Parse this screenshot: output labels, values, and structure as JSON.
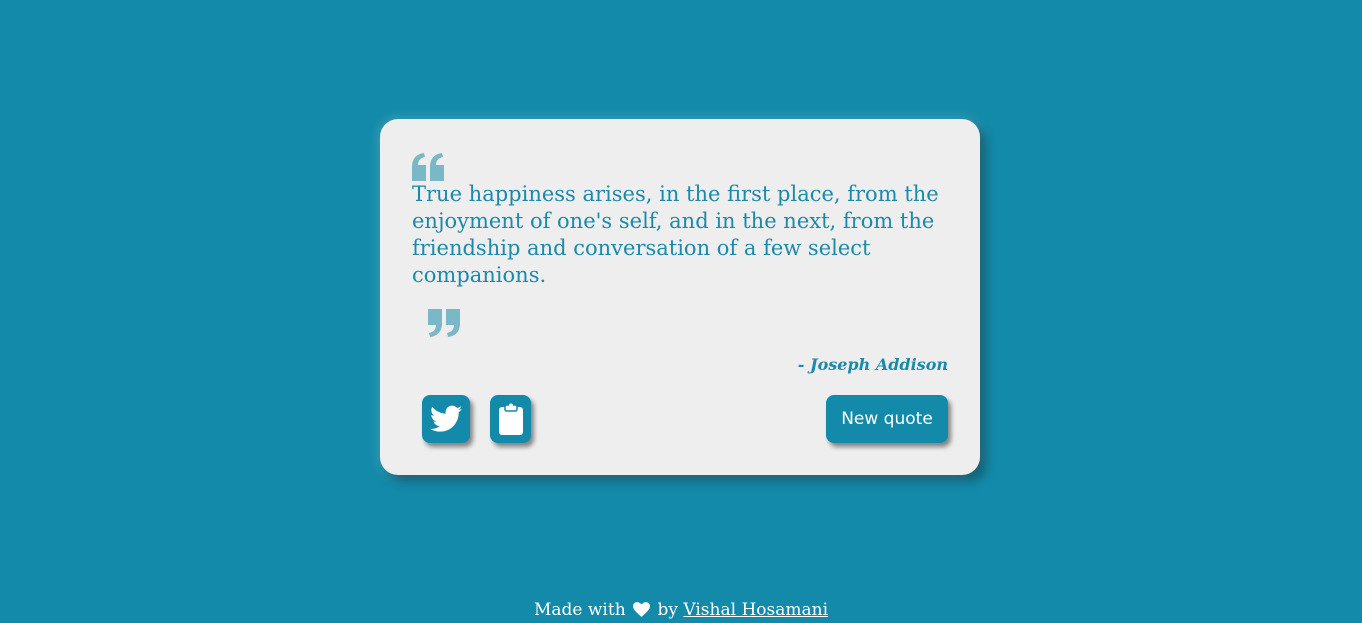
{
  "quote": {
    "text": "True happiness arises, in the first place, from the enjoyment of one's self, and in the next, from the friendship and conversation of a few select companions.",
    "author": "- Joseph Addison"
  },
  "actions": {
    "tweet_icon": "twitter-icon",
    "copy_icon": "clipboard-icon",
    "new_quote_label": "New quote"
  },
  "footer": {
    "prefix": "Made with",
    "heart_icon": "heart-icon",
    "by": "by",
    "author_link": "Vishal Hosamani"
  },
  "colors": {
    "background": "#138aa9",
    "card": "#eeeeee",
    "accent": "#1a8aaa",
    "quote_mark": "#7ab8c8"
  }
}
